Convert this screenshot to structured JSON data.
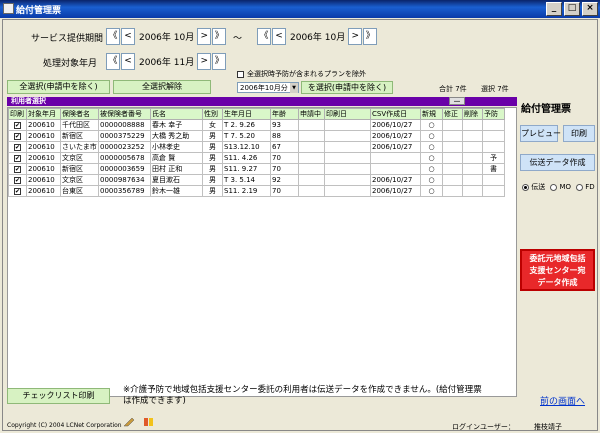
{
  "window": {
    "title": "給付管理票",
    "min": "_",
    "max": "□",
    "close": "×"
  },
  "filters": {
    "service_period_label": "サービス提供期間",
    "service_from": "2006年 10月",
    "tilde": "～",
    "service_to": "2006年 10月",
    "process_label": "処理対象年月",
    "process_month": "2006年 11月",
    "nav": {
      "first": "《",
      "prev": "<",
      "next": ">",
      "last": "》"
    }
  },
  "actions": {
    "select_all": "全選択(申請中を除く)",
    "clear_all": "全選択解除",
    "exclude_plan_label": "全選択時予防が含まれるプランを除外",
    "month_combo": "2006年10月分",
    "select_by_month": "を選択(申請中を除く)",
    "total": "合計 7件",
    "selected": "選択 7件"
  },
  "grid": {
    "title": "利用者選択",
    "more": "…",
    "headers": [
      "印刷",
      "対象年月",
      "保険者名",
      "被保険者番号",
      "氏名",
      "性別",
      "生年月日",
      "年齢",
      "申請中",
      "印刷日",
      "CSV作成日",
      "新規",
      "修正",
      "削除",
      "予防"
    ],
    "rows": [
      {
        "ym": "200610",
        "insurer": "千代田区",
        "num": "0000008888",
        "name": "春木 幸子",
        "sex": "女",
        "birth": "T 2. 9.26",
        "age": "93",
        "csv": "2006/10/27",
        "new": "○",
        "prev": ""
      },
      {
        "ym": "200610",
        "insurer": "新宿区",
        "num": "0000375229",
        "name": "大橋 秀之助",
        "sex": "男",
        "birth": "T 7. 5.20",
        "age": "88",
        "csv": "2006/10/27",
        "new": "○",
        "prev": ""
      },
      {
        "ym": "200610",
        "insurer": "さいたま市",
        "num": "0000023252",
        "name": "小林孝史",
        "sex": "男",
        "birth": "S13.12.10",
        "age": "67",
        "csv": "2006/10/27",
        "new": "○",
        "prev": ""
      },
      {
        "ym": "200610",
        "insurer": "文京区",
        "num": "0000005678",
        "name": "高倉 賢",
        "sex": "男",
        "birth": "S11. 4.26",
        "age": "70",
        "csv": "",
        "new": "○",
        "prev": "予"
      },
      {
        "ym": "200610",
        "insurer": "新宿区",
        "num": "0000003659",
        "name": "田村 正和",
        "sex": "男",
        "birth": "S11. 9.27",
        "age": "70",
        "csv": "",
        "new": "○",
        "prev": "書"
      },
      {
        "ym": "200610",
        "insurer": "文京区",
        "num": "0000987634",
        "name": "夏目漱石",
        "sex": "男",
        "birth": "T 3. 5.14",
        "age": "92",
        "csv": "2006/10/27",
        "new": "○",
        "prev": ""
      },
      {
        "ym": "200610",
        "insurer": "台東区",
        "num": "0000356789",
        "name": "鈴木一雄",
        "sex": "男",
        "birth": "S11. 2.19",
        "age": "70",
        "csv": "2006/10/27",
        "new": "○",
        "prev": ""
      }
    ]
  },
  "side": {
    "title": "給付管理票",
    "preview": "プレビュー",
    "print": "印刷",
    "transfer": "伝送データ作成",
    "radio_options": [
      "伝送",
      "MO",
      "FD"
    ],
    "red_button": [
      "委託元地域包括",
      "支援センター宛",
      "データ作成"
    ]
  },
  "bottom": {
    "checklist": "チェックリスト印刷",
    "note_line1": "※介護予防で地域包括支援センター委託の利用者は伝送データを作成できません。(給付管理票",
    "note_line2": "は作成できます)",
    "back": "前の画面へ",
    "copyright": "Copyright (C) 2004 LCNet Corporation",
    "login_label": "ログインユーザー：",
    "login_user": "推枝靖子"
  },
  "colors": {
    "purple": "#6a00a8",
    "green_btn": "#d7f2c2",
    "blue_btn": "#cfe3f7",
    "red_btn": "#e8282a"
  }
}
